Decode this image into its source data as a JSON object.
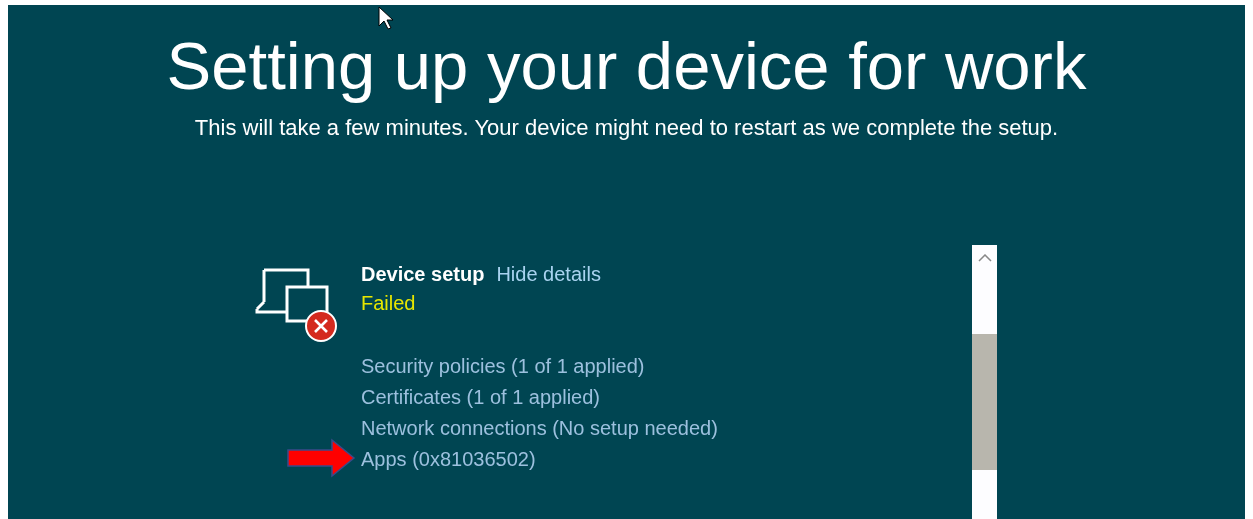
{
  "title": "Setting up your device for work",
  "subtitle": "This will take a few minutes. Your device might need to restart as we complete the setup.",
  "section": {
    "heading": "Device setup",
    "link": "Hide details",
    "status": {
      "text": "Failed",
      "kind": "failed"
    },
    "items": [
      {
        "text": "Security policies (1 of 1 applied)",
        "highlighted": false
      },
      {
        "text": "Certificates (1 of 1 applied)",
        "highlighted": false
      },
      {
        "text": "Network connections (No setup needed)",
        "highlighted": false
      },
      {
        "text": "Apps (0x81036502)",
        "highlighted": true
      }
    ]
  }
}
